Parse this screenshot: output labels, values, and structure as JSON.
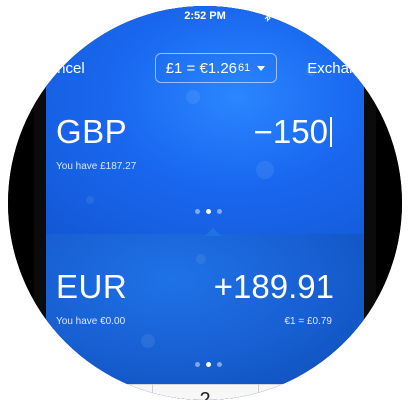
{
  "status_bar": {
    "time": "2:52 PM"
  },
  "nav": {
    "cancel_label": "Cancel",
    "exchange_label": "Exchange",
    "rate_main": "£1 = €1.26",
    "rate_small": "61"
  },
  "source": {
    "code": "GBP",
    "amount": "−150",
    "balance": "You have £187.27"
  },
  "target": {
    "code": "EUR",
    "amount": "+189.91",
    "balance": "You have €0.00",
    "rate": "€1 = £0.79"
  },
  "pager_top": {
    "count": 3,
    "active": 1
  },
  "pager_bottom": {
    "count": 3,
    "active": 1
  },
  "keypad": {
    "visible_digit": "2"
  },
  "colors": {
    "top_panel": "#1a68ef",
    "bottom_panel": "#175fd2",
    "text": "#ffffff"
  }
}
